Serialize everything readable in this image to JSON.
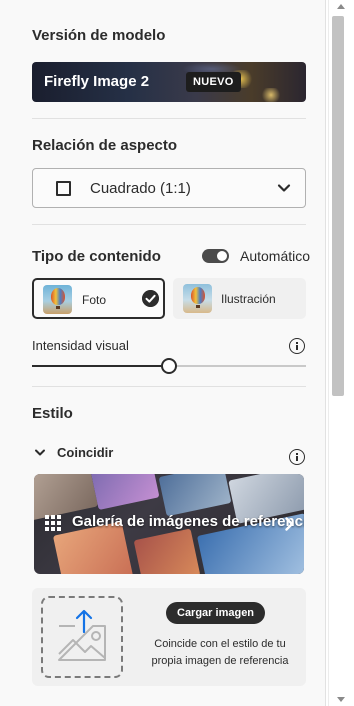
{
  "model": {
    "heading": "Versión de modelo",
    "name": "Firefly Image 2",
    "badge": "NUEVO",
    "chevron_icon": "chevron-right-icon"
  },
  "aspect": {
    "heading": "Relación de aspecto",
    "selected": "Cuadrado (1:1)",
    "icon": "square-icon"
  },
  "content_type": {
    "heading": "Tipo de contenido",
    "auto_label": "Automático",
    "auto_on": true,
    "options": [
      {
        "label": "Foto",
        "selected": true
      },
      {
        "label": "Ilustración",
        "selected": false
      }
    ]
  },
  "intensity": {
    "label": "Intensidad visual",
    "value": 0.5
  },
  "style": {
    "heading": "Estilo",
    "match_label": "Coincidir",
    "gallery_label": "Galería de imágenes de referencia",
    "upload_button": "Cargar imagen",
    "upload_desc": "Coincide con el estilo de tu propia imagen de referencia"
  },
  "colors": {
    "text": "#2c2c2c",
    "panel_bg": "#f9f9f9",
    "badge_bg": "#1d1d1d"
  }
}
